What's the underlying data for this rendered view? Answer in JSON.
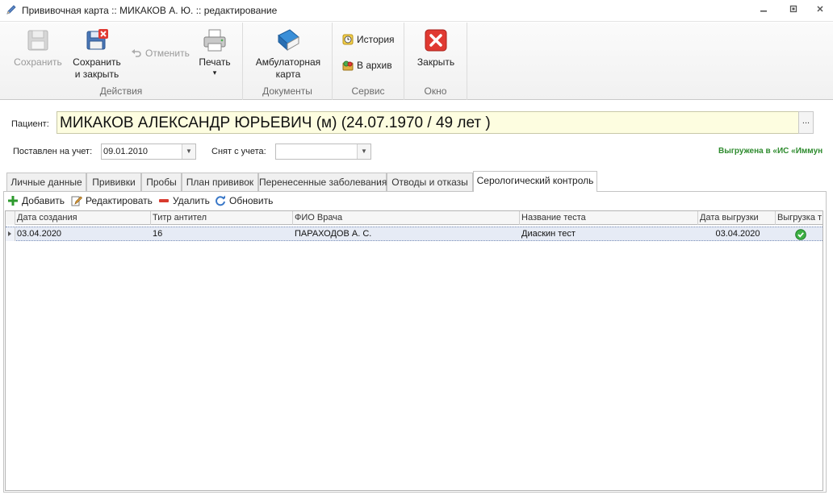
{
  "window": {
    "title": "Прививочная карта :: МИКАКОВ А. Ю. :: редактирование",
    "icons": {
      "app": "pencil-icon",
      "minimize": "minimize-icon",
      "restore": "restore-icon",
      "close": "close-icon"
    }
  },
  "ribbon": {
    "groups": {
      "actions": "Действия",
      "documents": "Документы",
      "service": "Сервис",
      "window": "Окно"
    },
    "save": "Сохранить",
    "save_close_1": "Сохранить",
    "save_close_2": "и закрыть",
    "undo": "Отменить",
    "print": "Печать",
    "print_arrow": "▾",
    "outpatient_1": "Амбулаторная",
    "outpatient_2": "карта",
    "history": "История",
    "archive": "В архив",
    "close": "Закрыть"
  },
  "patient": {
    "label": "Пациент:",
    "value": "МИКАКОВ АЛЕКСАНДР ЮРЬЕВИЧ (м) (24.07.1970 / 49 лет )",
    "more": "..."
  },
  "registration": {
    "registered_label": "Поставлен на учет:",
    "registered_value": "09.01.2010",
    "removed_label": "Снят с учета:",
    "removed_value": "",
    "export_status": "Выгружена в «ИС «Иммун"
  },
  "tabs": [
    "Личные данные",
    "Прививки",
    "Пробы",
    "План прививок",
    "Перенесенные заболевания",
    "Отводы и отказы",
    "Серологический контроль"
  ],
  "active_tab": 6,
  "toolbar": {
    "add": "Добавить",
    "edit": "Редактировать",
    "delete": "Удалить",
    "refresh": "Обновить"
  },
  "grid": {
    "columns": [
      "Дата создания",
      "Титр антител",
      "ФИО Врача",
      "Название теста",
      "Дата выгрузки",
      "Выгрузка т"
    ],
    "rows": [
      [
        "03.04.2020",
        "16",
        "ПАРАХОДОВ А. С.",
        "Диаскин тест",
        "03.04.2020",
        "check-icon"
      ]
    ]
  },
  "colors": {
    "patient_bg": "#fdfde0",
    "export_status": "#2e8b2e",
    "selected_row": "#e6ebf5",
    "close_red": "#e03a32"
  }
}
